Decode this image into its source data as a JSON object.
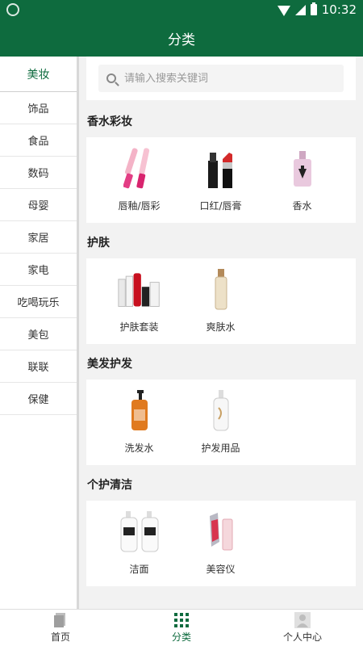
{
  "status_bar": {
    "time": "10:32"
  },
  "header": {
    "title": "分类"
  },
  "sidebar": {
    "items": [
      {
        "label": "美妆"
      },
      {
        "label": "饰品"
      },
      {
        "label": "食品"
      },
      {
        "label": "数码"
      },
      {
        "label": "母婴"
      },
      {
        "label": "家居"
      },
      {
        "label": "家电"
      },
      {
        "label": "吃喝玩乐"
      },
      {
        "label": "美包"
      },
      {
        "label": "联联"
      },
      {
        "label": "保健"
      }
    ]
  },
  "search": {
    "placeholder": "请输入搜索关键词"
  },
  "sections": [
    {
      "title": "香水彩妆",
      "items": [
        {
          "label": "唇釉/唇彩"
        },
        {
          "label": "口红/唇膏"
        },
        {
          "label": "香水"
        }
      ]
    },
    {
      "title": "护肤",
      "items": [
        {
          "label": "护肤套装"
        },
        {
          "label": "爽肤水"
        }
      ]
    },
    {
      "title": "美发护发",
      "items": [
        {
          "label": "洗发水"
        },
        {
          "label": "护发用品"
        }
      ]
    },
    {
      "title": "个护清洁",
      "items": [
        {
          "label": "洁面"
        },
        {
          "label": "美容仪"
        }
      ]
    }
  ],
  "bottom_nav": {
    "items": [
      {
        "label": "首页"
      },
      {
        "label": "分类"
      },
      {
        "label": "个人中心"
      }
    ]
  },
  "colors": {
    "brand": "#0e6b3e",
    "background": "#f2f2f2"
  }
}
